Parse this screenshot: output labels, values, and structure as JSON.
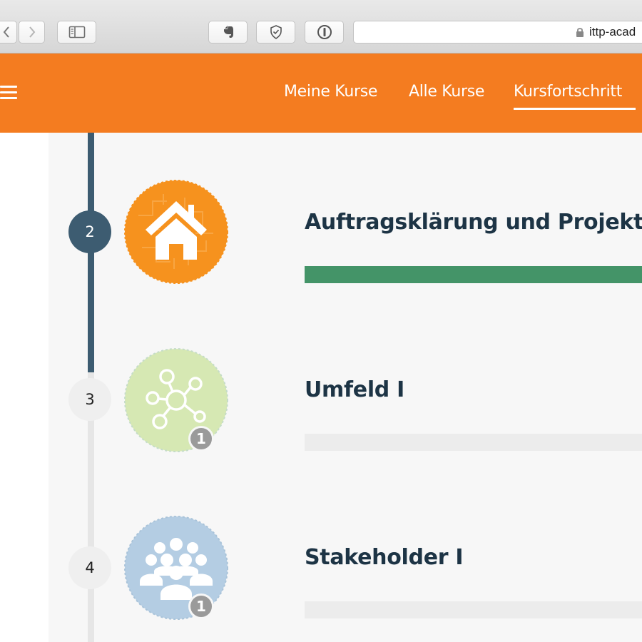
{
  "browser": {
    "url": "ittp-acad",
    "icons": [
      "back-icon",
      "forward-icon",
      "sidebar-icon",
      "evernote-icon",
      "shield-icon",
      "password-icon",
      "lock-icon"
    ]
  },
  "header": {
    "menu_icon": "hamburger-icon",
    "nav": [
      {
        "label": "Meine Kurse",
        "active": false
      },
      {
        "label": "Alle Kurse",
        "active": false
      },
      {
        "label": "Kursfortschritt",
        "active": true
      }
    ],
    "accent_color": "#f47c20"
  },
  "modules": [
    {
      "number": "2",
      "title": "Auftragsklärung und Projekt",
      "status": "active",
      "badge_icon": "house-icon",
      "badge_color": "#f6921e",
      "progress": 1.0,
      "count": null
    },
    {
      "number": "3",
      "title": "Umfeld I",
      "status": "pending",
      "badge_icon": "network-icon",
      "badge_color": "#d6e8b3",
      "progress": 0.0,
      "count": "1"
    },
    {
      "number": "4",
      "title": "Stakeholder I",
      "status": "pending",
      "badge_icon": "people-group-icon",
      "badge_color": "#b4cde3",
      "progress": 0.0,
      "count": "1"
    }
  ],
  "colors": {
    "timeline_done": "#3d5c71",
    "progress_green": "#449468",
    "title_text": "#1d3445"
  }
}
